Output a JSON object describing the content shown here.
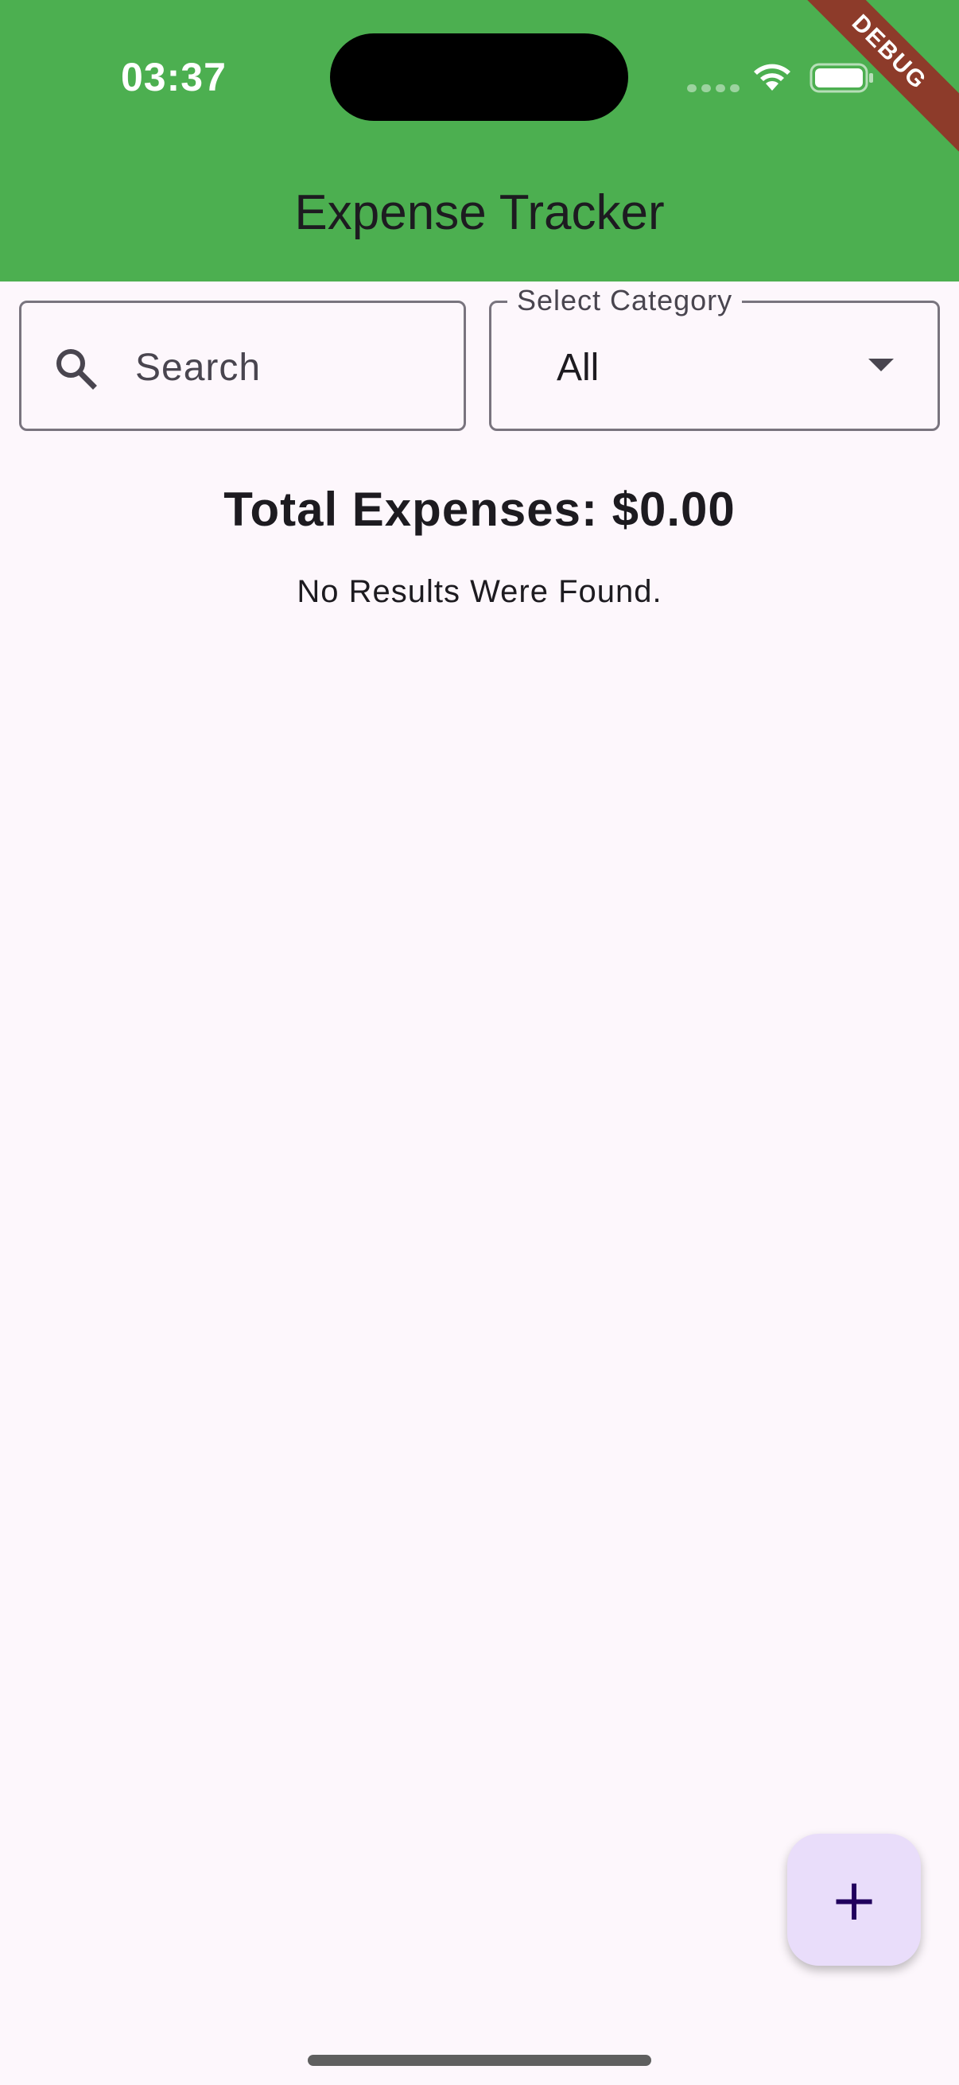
{
  "status_bar": {
    "time": "03:37"
  },
  "debug_banner": "DEBUG",
  "app_bar": {
    "title": "Expense Tracker",
    "color": "#4caf50"
  },
  "search": {
    "placeholder": "Search",
    "icon": "search-icon"
  },
  "category_select": {
    "label": "Select Category",
    "value": "All",
    "icon": "chevron-down-icon"
  },
  "summary": {
    "total": "Total Expenses: $0.00",
    "empty_message": "No Results Were Found."
  },
  "fab": {
    "label": "+",
    "icon": "add-icon",
    "color": "#e9ddfa"
  }
}
